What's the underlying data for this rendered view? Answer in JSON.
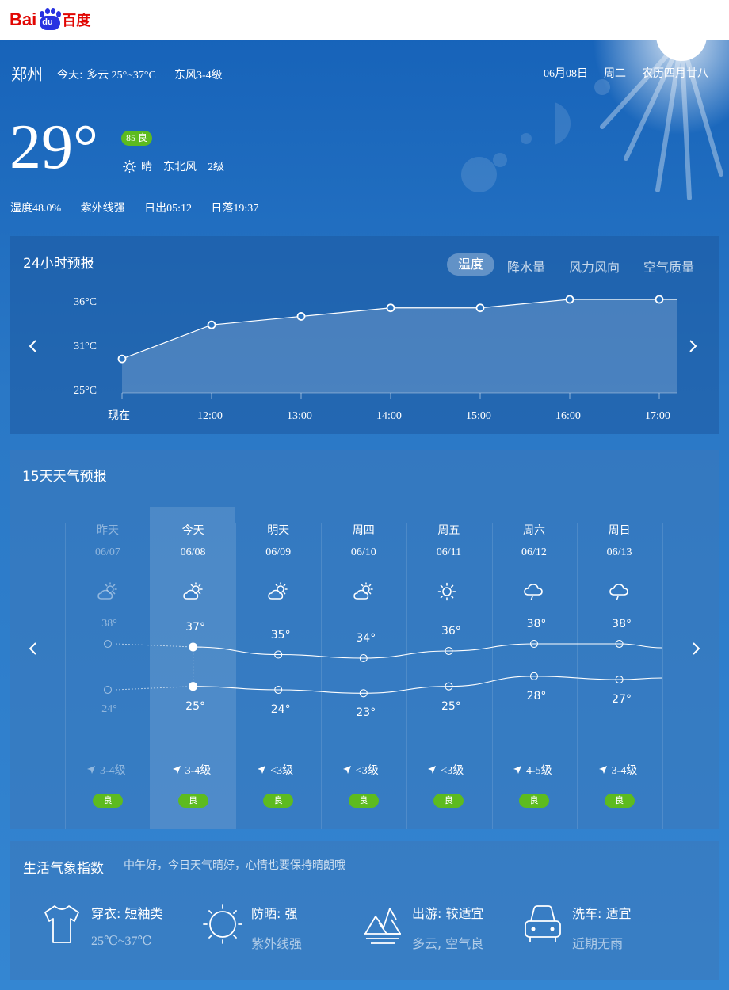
{
  "header": {
    "logo_bai": "Bai",
    "logo_du": "du",
    "logo_cn": "百度"
  },
  "current": {
    "city": "郑州",
    "today_label": "今天:",
    "today_summary": "多云 25°~37°C",
    "today_wind": "东风3-4级",
    "date": "06月08日",
    "weekday": "周二",
    "lunar": "农历四月廿八",
    "temperature": "29°",
    "aqi_badge": "85 良",
    "condition": "晴",
    "wind_dir": "东北风",
    "wind_level": "2级",
    "humidity": "湿度48.0%",
    "uv": "紫外线强",
    "sunrise": "日出05:12",
    "sunset": "日落19:37"
  },
  "hourly": {
    "title": "24小时预报",
    "tabs": [
      {
        "label": "温度",
        "active": true
      },
      {
        "label": "降水量",
        "active": false
      },
      {
        "label": "风力风向",
        "active": false
      },
      {
        "label": "空气质量",
        "active": false
      }
    ]
  },
  "chart_data": {
    "type": "area",
    "x": [
      "现在",
      "12:00",
      "13:00",
      "14:00",
      "15:00",
      "16:00",
      "17:00"
    ],
    "y_ticks": [
      "36°C",
      "31°C",
      "25°C"
    ],
    "ylim": [
      25,
      36
    ],
    "series": [
      {
        "values": [
          29,
          33,
          34,
          35,
          35,
          36,
          36
        ]
      }
    ],
    "grid": false
  },
  "daily": {
    "title": "15天天气预报",
    "days": [
      {
        "name": "昨天",
        "date": "06/07",
        "icon": "partly-cloudy-icon",
        "high": "38°",
        "low": "24°",
        "high_val": 38,
        "low_val": 24,
        "wind": "3-4级",
        "aqi": "良",
        "past": true
      },
      {
        "name": "今天",
        "date": "06/08",
        "icon": "partly-cloudy-icon",
        "high": "37°",
        "low": "25°",
        "high_val": 37,
        "low_val": 25,
        "wind": "3-4级",
        "aqi": "良",
        "past": false
      },
      {
        "name": "明天",
        "date": "06/09",
        "icon": "partly-cloudy-icon",
        "high": "35°",
        "low": "24°",
        "high_val": 35,
        "low_val": 24,
        "wind": "<3级",
        "aqi": "良",
        "past": false
      },
      {
        "name": "周四",
        "date": "06/10",
        "icon": "partly-cloudy-icon",
        "high": "34°",
        "low": "23°",
        "high_val": 34,
        "low_val": 23,
        "wind": "<3级",
        "aqi": "良",
        "past": false
      },
      {
        "name": "周五",
        "date": "06/11",
        "icon": "sunny-icon",
        "high": "36°",
        "low": "25°",
        "high_val": 36,
        "low_val": 25,
        "wind": "<3级",
        "aqi": "良",
        "past": false
      },
      {
        "name": "周六",
        "date": "06/12",
        "icon": "cloudy-rain-icon",
        "high": "38°",
        "low": "28°",
        "high_val": 38,
        "low_val": 28,
        "wind": "4-5级",
        "aqi": "良",
        "past": false
      },
      {
        "name": "周日",
        "date": "06/13",
        "icon": "cloudy-rain-icon",
        "high": "38°",
        "low": "27°",
        "high_val": 38,
        "low_val": 27,
        "wind": "3-4级",
        "aqi": "良",
        "past": false
      }
    ]
  },
  "life": {
    "title": "生活气象指数",
    "greeting": "中午好，今日天气晴好，心情也要保持晴朗哦",
    "items": [
      {
        "icon": "tshirt-icon",
        "title": "穿衣: 短袖类",
        "detail": "25℃~37℃"
      },
      {
        "icon": "sun-icon",
        "title": "防晒: 强",
        "detail": "紫外线强"
      },
      {
        "icon": "mountain-icon",
        "title": "出游: 较适宜",
        "detail": "多云, 空气良"
      },
      {
        "icon": "car-icon",
        "title": "洗车: 适宜",
        "detail": "近期无雨"
      }
    ]
  },
  "colors": {
    "aqi_good": "#5dbb1f",
    "logo_red": "#e10602",
    "logo_blue": "#2932e1"
  }
}
